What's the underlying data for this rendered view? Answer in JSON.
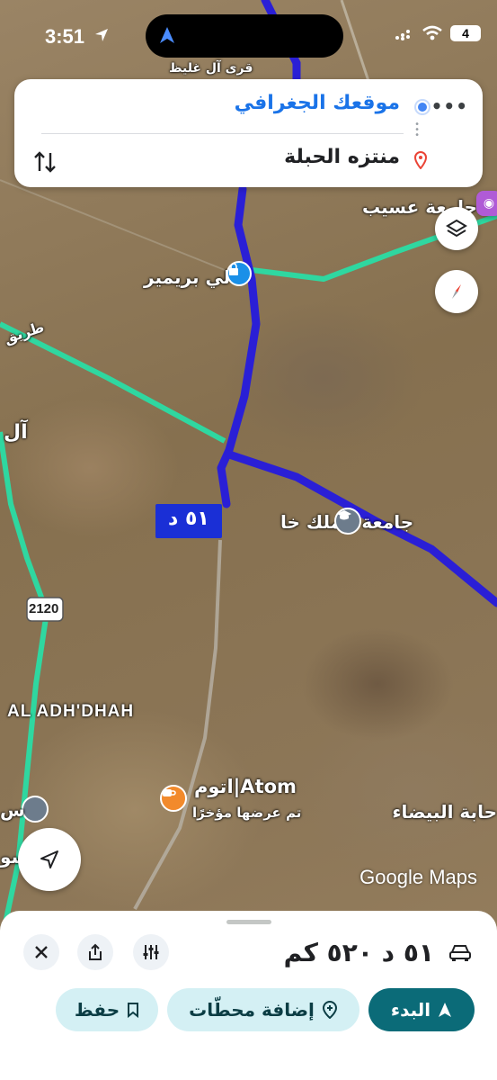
{
  "status": {
    "time": "3:51",
    "battery": "4"
  },
  "route_card": {
    "origin": "موقعك الجغرافي",
    "destination": "منتزه الحبلة",
    "more_label": "•••"
  },
  "map": {
    "labels": {
      "top_village": "قرى آل غليظ",
      "university_top": "جامعة عسيب",
      "li_primer": "لي بريمير",
      "road_left": "طريق",
      "al_left": "آل",
      "king_khalid_univ": "جامعة الملك خا",
      "road_number": "2120",
      "al_adhdhah": "AL ADH'DHAH",
      "atom_name": "اتوم|Atom",
      "atom_sub": "تم عرضها مؤخرًا",
      "bayda": "حابة البيضاء",
      "left_cut_1": "س",
      "left_cut_2": "سو"
    },
    "route_duration": "٥١ د",
    "attribution": "Google Maps"
  },
  "sheet": {
    "summary": "٥١ د ٥٢٠ كم",
    "start_label": "البدء",
    "add_stops_label": "إضافة محطّات",
    "save_label": "حفظ"
  },
  "colors": {
    "route": "#2a1fd6",
    "road_green": "#2fd7a0",
    "accent_teal": "#0b6b78",
    "pill_light": "#d4f0f4"
  }
}
